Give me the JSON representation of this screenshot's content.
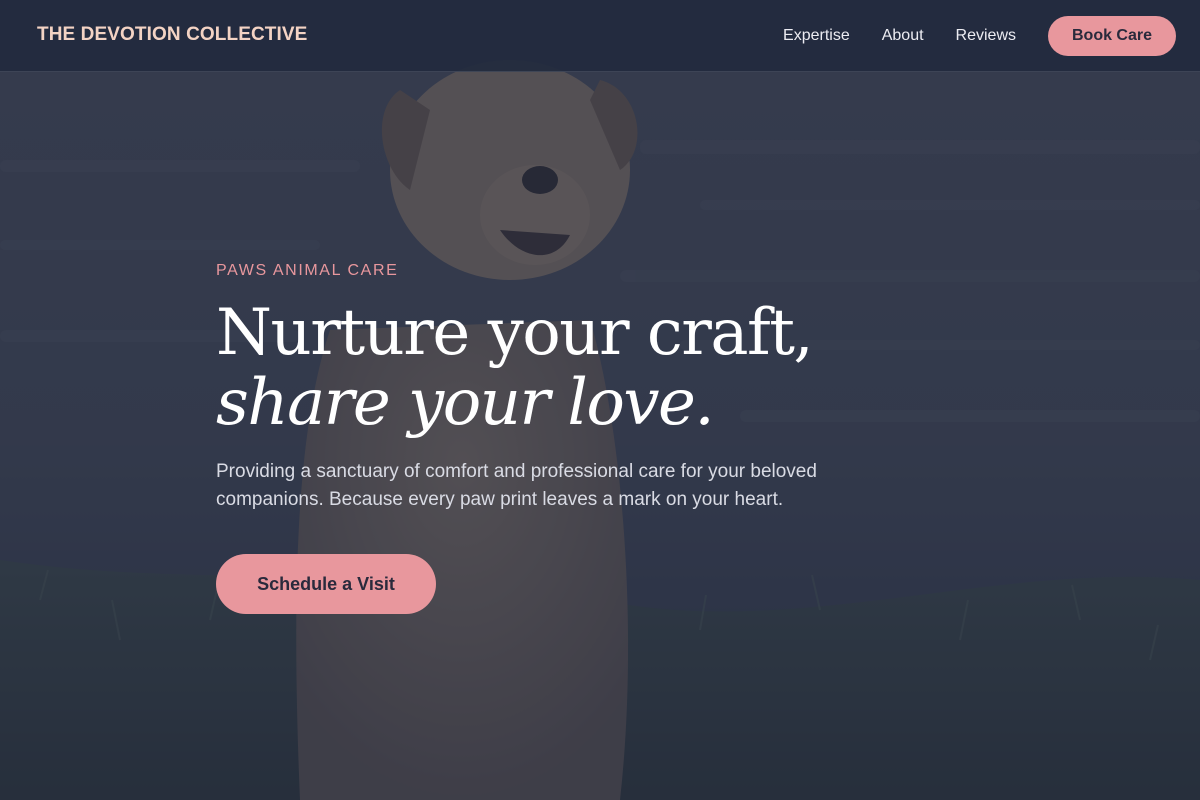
{
  "header": {
    "logo_text": "THE DEVOTION COLLECTIVE",
    "nav": [
      {
        "label": "Expertise"
      },
      {
        "label": "About"
      },
      {
        "label": "Reviews"
      }
    ],
    "cta_label": "Book Care"
  },
  "hero": {
    "eyebrow": "PAWS ANIMAL CARE",
    "headline_line1": "Nurture your craft,",
    "headline_line2": "share your love.",
    "subtext": "Providing a sanctuary of comfort and professional care for your beloved companions. Because every paw print leaves a mark on your heart.",
    "cta_label": "Schedule a Visit",
    "background_image": "dog-photo"
  },
  "colors": {
    "header_bg": "#222a3e",
    "accent_pink": "#e8979d",
    "logo_peach": "#f3d3c4",
    "headline_white": "#ffffff",
    "overlay": "#242c42"
  }
}
